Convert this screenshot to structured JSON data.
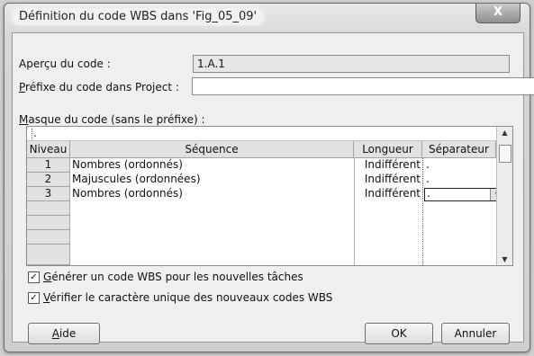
{
  "window": {
    "title": "Définition du code WBS dans 'Fig_05_09'",
    "close_glyph": "X"
  },
  "apercu": {
    "label": "Aperçu du code :",
    "value": "1.A.1"
  },
  "prefixe": {
    "label_first": "P",
    "label_rest": "réfixe du code dans Project :",
    "value": ""
  },
  "masque": {
    "label_first": "M",
    "label_rest": "asque du code (sans le préfixe) :"
  },
  "grid": {
    "edit_value": ".",
    "columns": [
      "Niveau",
      "Séquence",
      "Longueur",
      "Séparateur"
    ],
    "rows": [
      {
        "niveau": "1",
        "sequence": "Nombres (ordonnés)",
        "longueur": "Indifférent",
        "separateur": "."
      },
      {
        "niveau": "2",
        "sequence": "Majuscules (ordonnées)",
        "longueur": "Indifférent",
        "separateur": "."
      },
      {
        "niveau": "3",
        "sequence": "Nombres (ordonnés)",
        "longueur": "Indifférent",
        "separateur": "."
      }
    ]
  },
  "options": {
    "generer": {
      "checked": true,
      "label_first": "G",
      "label_rest": "énérer un code WBS pour les nouvelles tâches"
    },
    "verifier": {
      "checked": true,
      "label_first": "V",
      "label_rest": "érifier le caractère unique des nouveaux codes WBS"
    }
  },
  "buttons": {
    "aide_first": "A",
    "aide_rest": "ide",
    "ok": "OK",
    "annuler": "Annuler"
  },
  "icons": {
    "check": "✓",
    "dropdown": "▼",
    "scroll_up": "▲",
    "scroll_down": "▼"
  }
}
